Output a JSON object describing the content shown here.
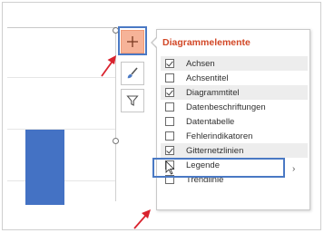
{
  "panel": {
    "title": "Diagrammelemente",
    "items": [
      {
        "label": "Achsen",
        "checked": true
      },
      {
        "label": "Achsentitel",
        "checked": false
      },
      {
        "label": "Diagrammtitel",
        "checked": true
      },
      {
        "label": "Datenbeschriftungen",
        "checked": false
      },
      {
        "label": "Datentabelle",
        "checked": false
      },
      {
        "label": "Fehlerindikatoren",
        "checked": false
      },
      {
        "label": "Gitternetzlinien",
        "checked": true
      },
      {
        "label": "Legende",
        "checked": false
      },
      {
        "label": "Trendlinie",
        "checked": false
      }
    ],
    "submenu_icon": "chevron-right-icon"
  },
  "side_buttons": [
    {
      "icon": "plus-icon",
      "name": "chart-elements-button"
    },
    {
      "icon": "brush-icon",
      "name": "chart-styles-button"
    },
    {
      "icon": "filter-icon",
      "name": "chart-filters-button"
    }
  ],
  "colors": {
    "accent": "#d24726",
    "bar": "#4472c4",
    "highlight": "#4a79c4",
    "annotation_arrow": "#d9232e",
    "plus_button": "#f6b398"
  }
}
